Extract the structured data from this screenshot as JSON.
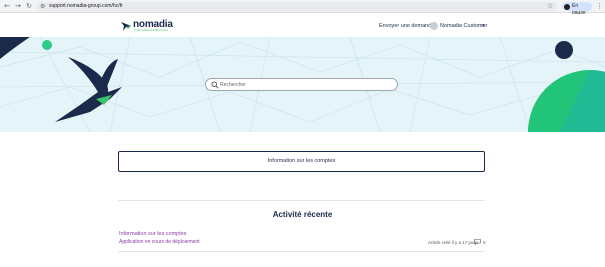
{
  "browser": {
    "url": "support.nomadia-group.com/hc/fr",
    "pause_label": "En pause",
    "back_icon": "arrow-left-icon",
    "forward_icon": "arrow-right-icon",
    "reload_icon": "reload-icon"
  },
  "header": {
    "logo_text": "nomadia",
    "logo_tagline": "smart mobility and field service",
    "submit_request": "Envoyer une demande",
    "user_name": "Nomadia Customer"
  },
  "hero": {
    "search_placeholder": "Rechercher"
  },
  "categories": [
    {
      "title": "Information sur les comptes"
    }
  ],
  "activity": {
    "heading": "Activité récente",
    "items": [
      {
        "title": "Information sur les comptes",
        "section": "Application en cours de déploiement",
        "meta": "Article créé il y a 17 jours",
        "comments": "0"
      }
    ]
  },
  "colors": {
    "navy": "#1b2a4a",
    "green": "#3cc46d",
    "purple_link": "#8a3ea6",
    "hero_bg": "#e4f4f8"
  }
}
